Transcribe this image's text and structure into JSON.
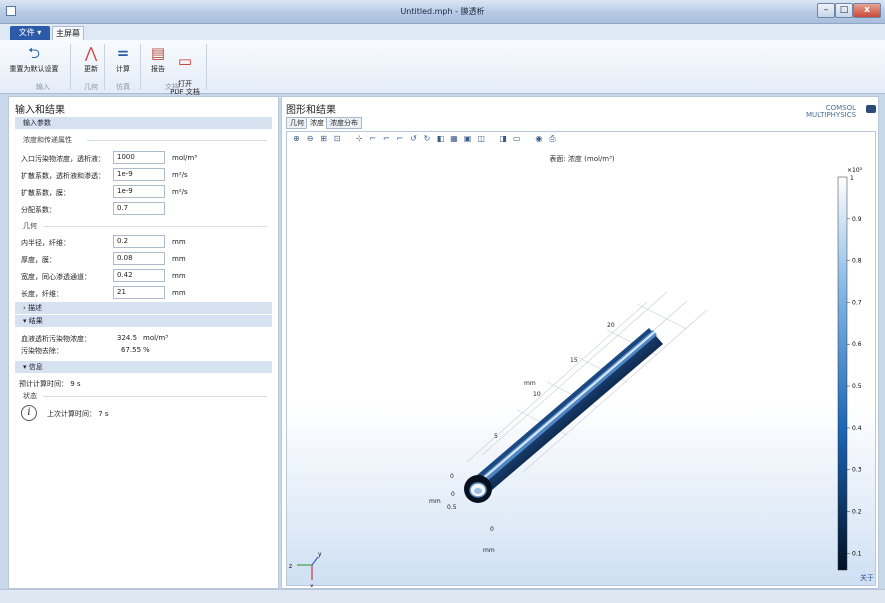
{
  "window": {
    "title": "Untitled.mph - 膜透析",
    "min": "–",
    "max": "□",
    "close": "x"
  },
  "ribbon": {
    "file_tab": "文件 ▾",
    "home_tab": "主屏幕",
    "buttons": [
      {
        "label": "重置为默认设置",
        "icon": "reset-icon"
      },
      {
        "label": "更新",
        "icon": "geometry-update-icon"
      },
      {
        "label": "计算",
        "icon": "compute-icon"
      },
      {
        "label": "报告",
        "icon": "report-icon"
      },
      {
        "label": "打开\nPDF 文档",
        "icon": "pdf-icon"
      }
    ],
    "groups": [
      "输入",
      "几何",
      "仿真",
      "文档"
    ]
  },
  "left": {
    "title": "输入和结果",
    "input_section": "输入参数",
    "group_props": "浓度和传递属性",
    "params_props": [
      {
        "label": "入口污染物浓度，透析液：",
        "value": "1000",
        "unit": "mol/m³"
      },
      {
        "label": "扩散系数，透析液和渗透：",
        "value": "1e-9",
        "unit": "m²/s"
      },
      {
        "label": "扩散系数，膜：",
        "value": "1e-9",
        "unit": "m²/s"
      },
      {
        "label": "分配系数：",
        "value": "0.7",
        "unit": ""
      }
    ],
    "group_geom": "几何",
    "params_geom": [
      {
        "label": "内半径，纤维：",
        "value": "0.2",
        "unit": "mm"
      },
      {
        "label": "厚度，膜：",
        "value": "0.08",
        "unit": "mm"
      },
      {
        "label": "宽度，同心渗透通道：",
        "value": "0.42",
        "unit": "mm"
      },
      {
        "label": "长度，纤维：",
        "value": "21",
        "unit": "mm"
      }
    ],
    "desc_section": "描述",
    "results_section": "结果",
    "results": [
      {
        "label": "血液透析污染物浓度：",
        "value": "324.5",
        "unit": "mol/m³"
      },
      {
        "label": "污染物去除：",
        "value": "67.55",
        "unit": "%"
      }
    ],
    "info_section": "信息",
    "expected_time": "预计计算时间： 9 s",
    "status_group": "状态",
    "last_time": "上次计算时间： 7 s"
  },
  "right": {
    "title": "图形和结果",
    "logo": "COMSOL\nMULTIPHYSICS",
    "tabs": [
      "几何",
      "浓度",
      "浓度分布"
    ],
    "active_tab": 1,
    "caption": "表面: 浓度 (mol/m³)",
    "colorbar": {
      "multiplier": "×10³",
      "max": "1",
      "ticks": [
        "0.9",
        "0.8",
        "0.7",
        "0.6",
        "0.5",
        "0.4",
        "0.3",
        "0.2",
        "0.1"
      ],
      "bottom": "0.1"
    },
    "axis_labels": [
      "20",
      "15",
      "10",
      "5",
      "0",
      "0",
      "0.5",
      "0"
    ],
    "unit_marks": [
      "mm",
      "mm",
      "mm"
    ],
    "triad": {
      "x": "z",
      "y": "y",
      "z": "x"
    }
  },
  "footer": {
    "about": "关于"
  }
}
